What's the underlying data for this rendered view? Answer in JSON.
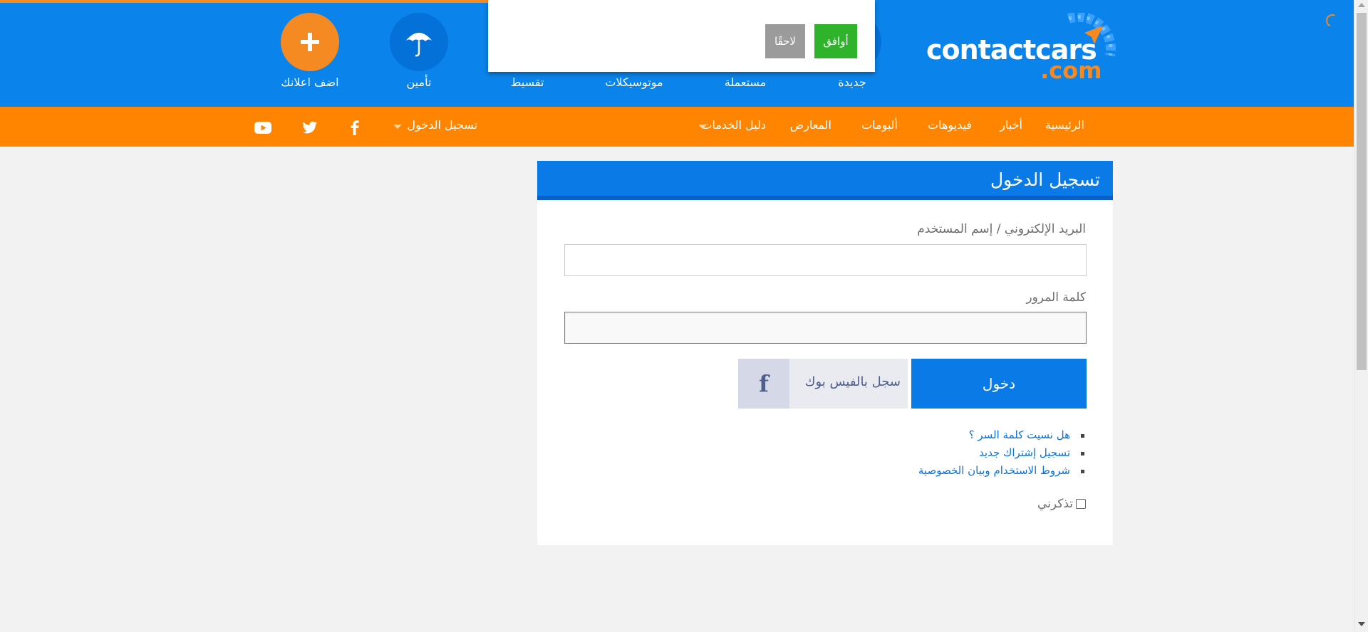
{
  "header": {
    "logo_main": "contactcars",
    "logo_sub": ".com",
    "nav": [
      {
        "label": "جديدة",
        "icon": "new-car-icon"
      },
      {
        "label": "مستعملة",
        "icon": "used-car-icon"
      },
      {
        "label": "موتوسيكلات",
        "icon": "motorcycle-icon"
      },
      {
        "label": "تقسيط",
        "icon": "installment-icon"
      },
      {
        "label": "تأمين",
        "icon": "umbrella-icon"
      },
      {
        "label": "اضف اعلانك",
        "icon": "plus-icon"
      }
    ]
  },
  "consent": {
    "agree_label": "أوافق",
    "later_label": "لاحقًا"
  },
  "menu": {
    "items": [
      "الرئيسية",
      "أخبار",
      "فيديوهات",
      "ألبومات",
      "المعارض",
      "دليل الخدمات"
    ],
    "login_label": "تسجيل الدخول",
    "social": [
      "facebook-icon",
      "twitter-icon",
      "youtube-icon"
    ]
  },
  "login": {
    "title": "تسجيل الدخول",
    "email_label": "البريد الإلكتروني / إسم المستخدم",
    "email_value": "",
    "password_label": "كلمة المرور",
    "password_value": "",
    "login_button": "دخول",
    "facebook_button": "سجل بالفيس بوك",
    "facebook_glyph": "f",
    "links": [
      "هل نسيت كلمة السر ؟",
      "تسجيل إشتراك جديد",
      "شروط الاستخدام وبيان الخصوصية"
    ],
    "remember_label": "تذكرني",
    "remember_checked": false
  },
  "colors": {
    "header_blue": "#0a84ea",
    "menu_orange": "#ff8400",
    "button_blue": "#0a7ae6",
    "agree_green": "#2fb32b"
  }
}
